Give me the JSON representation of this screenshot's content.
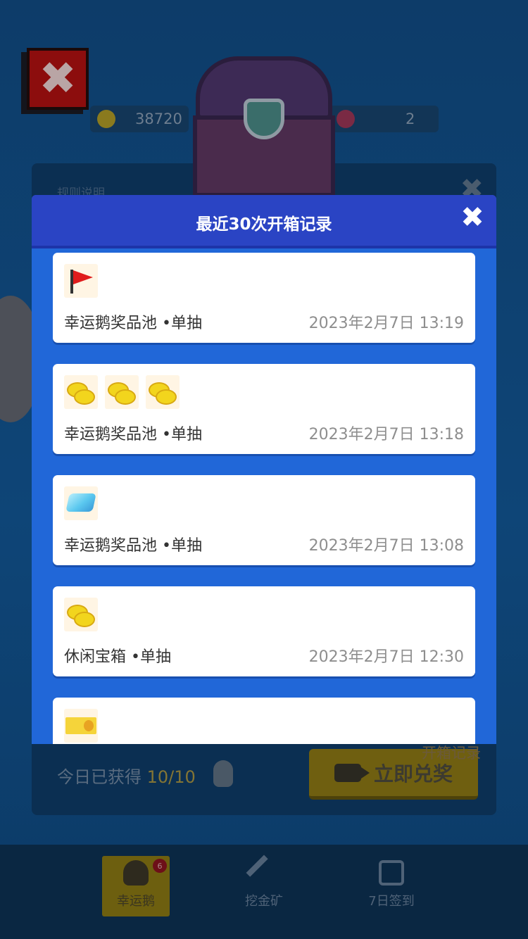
{
  "background": {
    "coins": "38720",
    "tickets": "2",
    "rules_label": "规则说明",
    "today_label": "今日已获得",
    "today_count": "10/10",
    "redeem_label": "立即兑奖",
    "history_label": "开箱记录"
  },
  "tabbar": {
    "tabs": [
      {
        "label": "幸运鹅",
        "icon": "penguin-icon",
        "badge": "6"
      },
      {
        "label": "挖金矿",
        "icon": "pickaxe-icon"
      },
      {
        "label": "7日签到",
        "icon": "calendar-icon"
      }
    ]
  },
  "modal": {
    "title": "最近30次开箱记录",
    "records": [
      {
        "items": [
          "red-flag-icon"
        ],
        "source": "幸运鹅奖品池",
        "mode": "•单抽",
        "time": "2023年2月7日 13:19"
      },
      {
        "items": [
          "gold-coins-icon",
          "gold-coins-icon",
          "gold-coins-icon"
        ],
        "source": "幸运鹅奖品池",
        "mode": "•单抽",
        "time": "2023年2月7日 13:18"
      },
      {
        "items": [
          "diamond-icon"
        ],
        "source": "幸运鹅奖品池",
        "mode": "•单抽",
        "time": "2023年2月7日 13:08"
      },
      {
        "items": [
          "gold-coins-icon"
        ],
        "source": "休闲宝箱",
        "mode": "•单抽",
        "time": "2023年2月7日 12:30"
      },
      {
        "items": [
          "voucher-icon"
        ]
      }
    ]
  }
}
